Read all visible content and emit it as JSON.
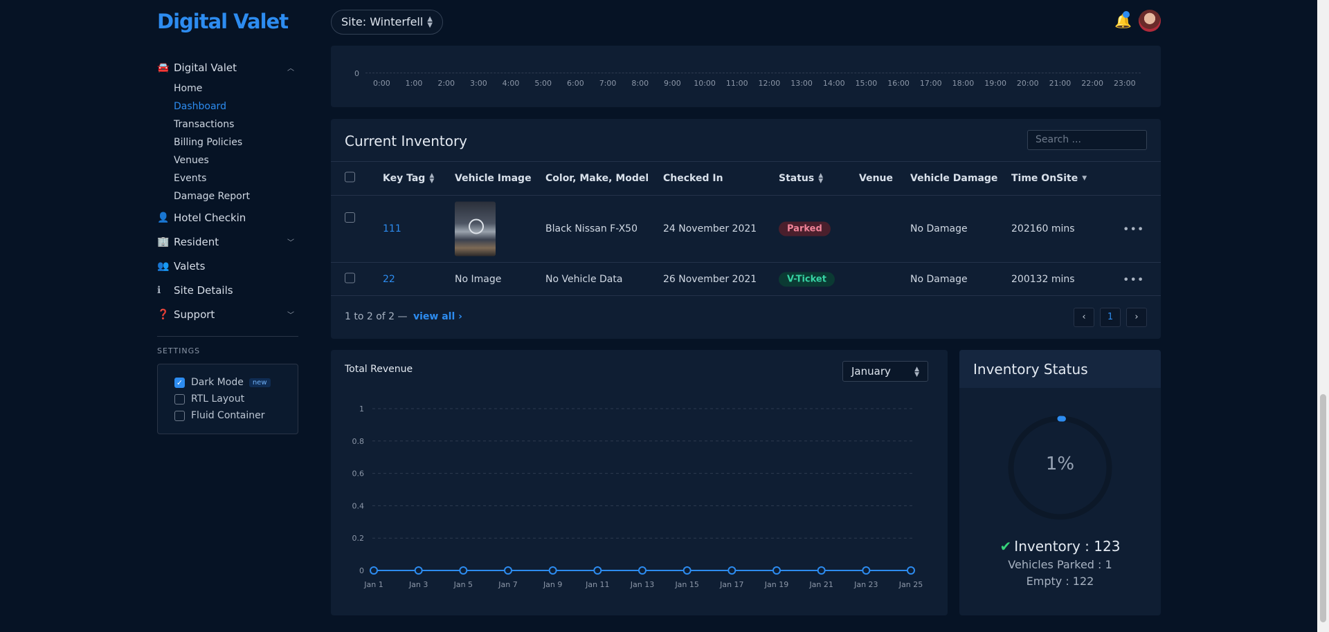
{
  "brand": "Digital Valet",
  "topbar": {
    "site_label": "Site: Winterfell"
  },
  "sidebar": {
    "sections": [
      {
        "label": "Digital Valet",
        "icon": "car-icon",
        "expanded": true,
        "items": [
          "Home",
          "Dashboard",
          "Transactions",
          "Billing Policies",
          "Venues",
          "Events",
          "Damage Report"
        ],
        "active": "Dashboard"
      },
      {
        "label": "Hotel Checkin",
        "icon": "user-check-icon"
      },
      {
        "label": "Resident",
        "icon": "building-icon"
      },
      {
        "label": "Valets",
        "icon": "users-icon"
      },
      {
        "label": "Site Details",
        "icon": "info-icon"
      },
      {
        "label": "Support",
        "icon": "question-circle-icon"
      }
    ]
  },
  "settings": {
    "title": "SETTINGS",
    "dark_mode": "Dark Mode",
    "new_badge": "new",
    "rtl": "RTL Layout",
    "fluid": "Fluid Container"
  },
  "hourly_chart": {
    "zero": "0",
    "hours": [
      "0:00",
      "1:00",
      "2:00",
      "3:00",
      "4:00",
      "5:00",
      "6:00",
      "7:00",
      "8:00",
      "9:00",
      "10:00",
      "11:00",
      "12:00",
      "13:00",
      "14:00",
      "15:00",
      "16:00",
      "17:00",
      "18:00",
      "19:00",
      "20:00",
      "21:00",
      "22:00",
      "23:00"
    ]
  },
  "inventory": {
    "title": "Current Inventory",
    "search_placeholder": "Search ...",
    "columns": [
      "Key Tag",
      "Vehicle Image",
      "Color, Make, Model",
      "Checked In",
      "Status",
      "Venue",
      "Vehicle Damage",
      "Time OnSite"
    ],
    "rows": [
      {
        "key_tag": "111",
        "image": "",
        "vehicle": "Black Nissan F-X50",
        "checked_in": "24 November 2021",
        "status": "Parked",
        "venue": "",
        "damage": "No Damage",
        "time": "202160 mins"
      },
      {
        "key_tag": "22",
        "image": "No Image",
        "vehicle": "No Vehicle Data",
        "checked_in": "26 November 2021",
        "status": "V-Ticket",
        "venue": "",
        "damage": "No Damage",
        "time": "200132 mins"
      }
    ],
    "footer": "1 to 2 of 2 —",
    "view_all": "view all",
    "page": "1"
  },
  "revenue": {
    "title": "Total Revenue",
    "month": "January"
  },
  "chart_data": {
    "type": "line",
    "title": "Total Revenue",
    "x": [
      "Jan 1",
      "Jan 3",
      "Jan 5",
      "Jan 7",
      "Jan 9",
      "Jan 11",
      "Jan 13",
      "Jan 15",
      "Jan 17",
      "Jan 19",
      "Jan 21",
      "Jan 23",
      "Jan 25"
    ],
    "series": [
      {
        "values": [
          0,
          0,
          0,
          0,
          0,
          0,
          0,
          0,
          0,
          0,
          0,
          0,
          0
        ]
      }
    ],
    "yticks": [
      "0",
      "0.2",
      "0.4",
      "0.6",
      "0.8",
      "1"
    ],
    "ylim": [
      0,
      1
    ],
    "grid": true,
    "color": "#2d8cf0"
  },
  "status": {
    "title": "Inventory Status",
    "percent_value": 1,
    "percent_label": "1%",
    "inventory": "Inventory : 123",
    "parked": "Vehicles Parked : 1",
    "empty": "Empty : 122"
  },
  "colors": {
    "accent": "#2d8cf0",
    "background": "#061325",
    "card": "#0f1e33"
  }
}
